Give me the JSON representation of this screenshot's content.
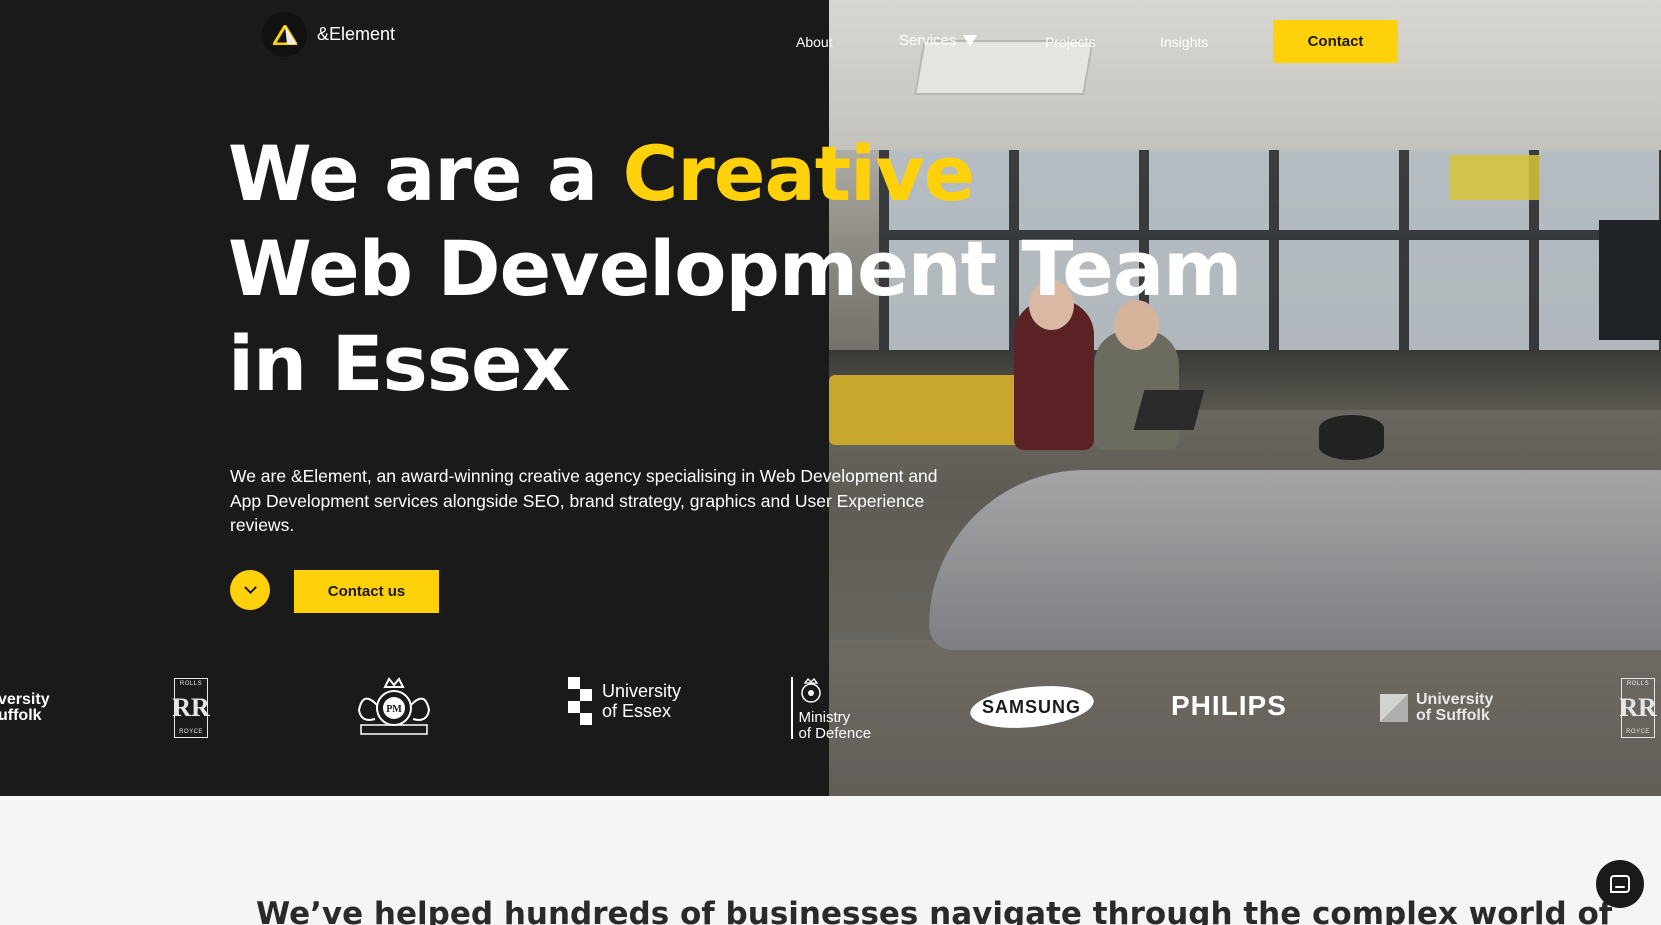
{
  "header": {
    "logo_text": "&Element",
    "nav": [
      {
        "label": "About"
      },
      {
        "label": "Services"
      },
      {
        "label": "Projects"
      },
      {
        "label": "Insights"
      }
    ],
    "contact_label": "Contact"
  },
  "hero": {
    "headline_part1": "We are a ",
    "headline_accent": "Creative",
    "headline_line2": "Web Development Team",
    "headline_line3": "in Essex",
    "lede": "We are &Element, an award-winning creative agency specialising in Web Development and App Development services alongside SEO, brand strategy, graphics and User Experience reviews.",
    "contact_us_label": "Contact us"
  },
  "clients": {
    "uni_suffolk_partial": [
      "versity",
      "uffolk"
    ],
    "rolls_royce": {
      "top": "ROLLS",
      "mark": "RR",
      "bottom": "ROYCE"
    },
    "university_of_essex": [
      "University",
      "of Essex"
    ],
    "ministry_of_defence": [
      "Ministry",
      "of Defence"
    ],
    "samsung": "SAMSUNG",
    "philips": "PHILIPS",
    "university_of_suffolk": [
      "University",
      "of Suffolk"
    ]
  },
  "section": {
    "heading": "We’ve helped hundreds of businesses navigate through the complex world of"
  },
  "colors": {
    "accent": "#fed10a",
    "dark": "#1b1a1b",
    "light_bg": "#f5f5f5"
  },
  "icons": [
    "logo-triangle-icon",
    "caret-down-icon",
    "chevron-down-icon",
    "chat-icon"
  ]
}
